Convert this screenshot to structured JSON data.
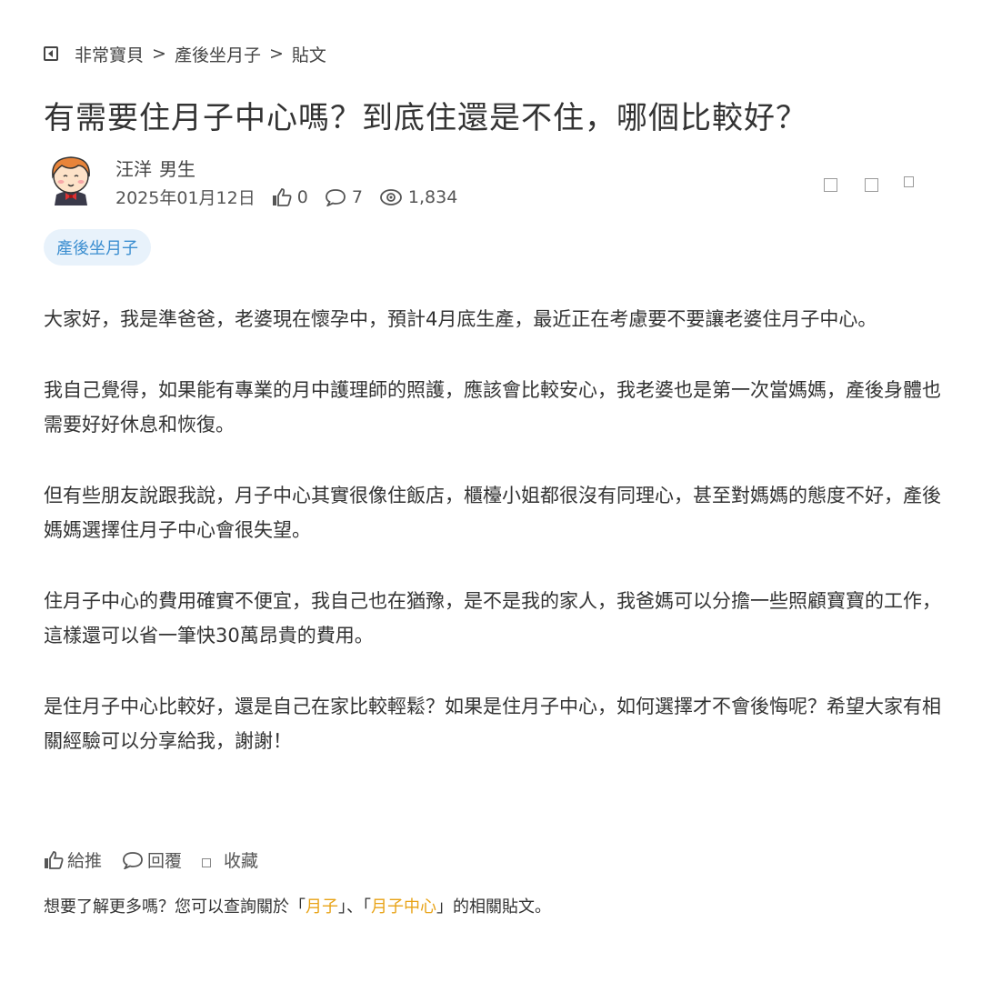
{
  "breadcrumb": {
    "items": [
      "非常寶貝",
      "產後坐月子",
      "貼文"
    ],
    "separator": ">"
  },
  "post": {
    "title": "有需要住月子中心嗎？到底住還是不住，哪個比較好？",
    "author": {
      "name": "汪洋",
      "gender": "男生"
    },
    "date": "2025年01月12日",
    "likes": "0",
    "replies": "7",
    "views": "1,834",
    "tag": "產後坐月子",
    "paragraphs": [
      "大家好，我是準爸爸，老婆現在懷孕中，預計4月底生產，最近正在考慮要不要讓老婆住月子中心。",
      "我自己覺得，如果能有專業的月中護理師的照護，應該會比較安心，我老婆也是第一次當媽媽，產後身體也需要好好休息和恢復。",
      "但有些朋友說跟我說，月子中心其實很像住飯店，櫃檯小姐都很沒有同理心，甚至對媽媽的態度不好，產後媽媽選擇住月子中心會很失望。",
      "住月子中心的費用確實不便宜，我自己也在猶豫，是不是我的家人，我爸媽可以分擔一些照顧寶寶的工作，這樣還可以省一筆快30萬昂貴的費用。",
      "是住月子中心比較好，還是自己在家比較輕鬆？如果是住月子中心，如何選擇才不會後悔呢？希望大家有相關經驗可以分享給我，謝謝！"
    ]
  },
  "actions": {
    "like": "給推",
    "reply": "回覆",
    "favorite": "收藏"
  },
  "related": {
    "prefix": "想要了解更多嗎？您可以查詢關於「",
    "keyword1": "月子",
    "middle": "」、「",
    "keyword2": "月子中心",
    "suffix": "」的相關貼文。"
  },
  "colors": {
    "tag_bg": "#e8f2fb",
    "tag_text": "#3b8ed0",
    "keyword": "#e8a317",
    "text": "#333333"
  },
  "icons": [
    "back-icon",
    "thumbs-up-icon",
    "comment-icon",
    "eye-icon",
    "bookmark-icon"
  ]
}
